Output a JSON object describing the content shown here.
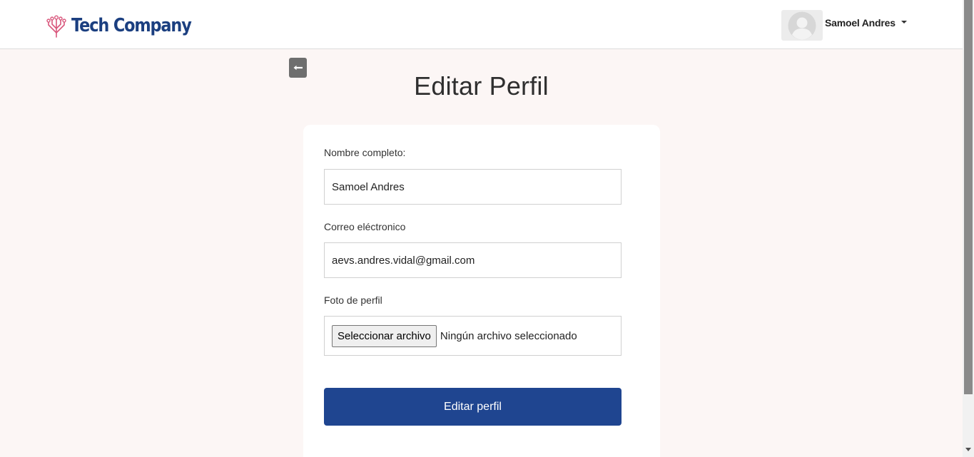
{
  "header": {
    "brand_name": "Tech Company",
    "logo_icon": "circuit-logo-icon",
    "user": {
      "name": "Samoel Andres",
      "avatar_icon": "user-avatar-icon",
      "dropdown_icon": "caret-down-icon"
    }
  },
  "back_button": {
    "icon": "arrow-left-icon"
  },
  "page": {
    "title": "Editar Perfil"
  },
  "form": {
    "full_name": {
      "label": "Nombre completo:",
      "value": "Samoel Andres"
    },
    "email": {
      "label": "Correo eléctronico",
      "value": "aevs.andres.vidal@gmail.com"
    },
    "photo": {
      "label": "Foto de perfil",
      "button_label": "Seleccionar archivo",
      "status": "Ningún archivo seleccionado"
    },
    "submit_label": "Editar perfil"
  },
  "colors": {
    "brand": "#1b3f80",
    "logo_accent": "#d9577c",
    "primary_button": "#1f4590",
    "page_background": "#fcf6f5"
  }
}
